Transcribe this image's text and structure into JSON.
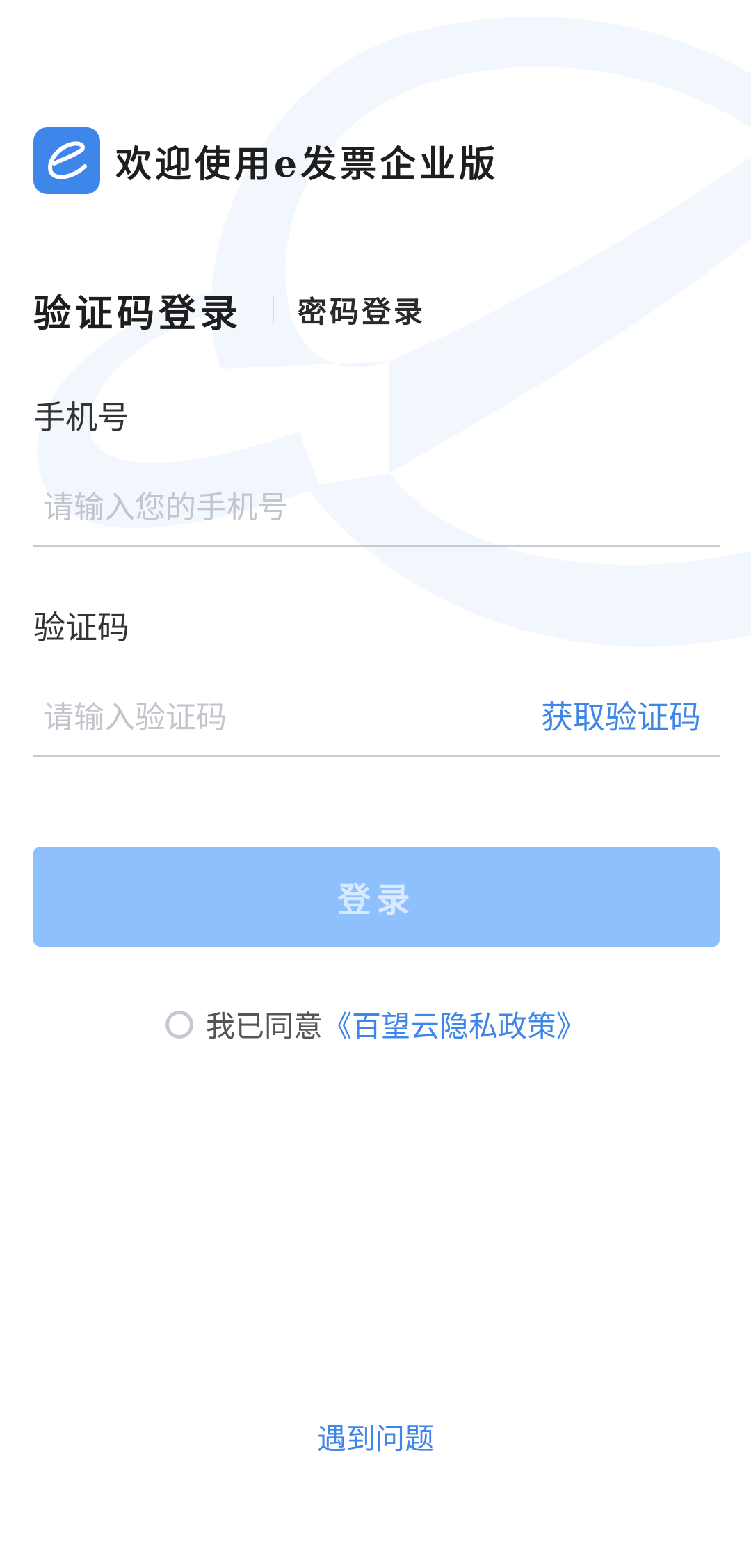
{
  "header": {
    "logo_icon": "e-logo-icon",
    "title": "欢迎使用e发票企业版"
  },
  "tabs": {
    "active": "验证码登录",
    "inactive": "密码登录"
  },
  "phone": {
    "label": "手机号",
    "placeholder": "请输入您的手机号",
    "value": ""
  },
  "code": {
    "label": "验证码",
    "placeholder": "请输入验证码",
    "value": "",
    "get_code_label": "获取验证码"
  },
  "login": {
    "label": "登录",
    "enabled": false
  },
  "agreement": {
    "checked": false,
    "text": "我已同意",
    "policy_link": "《百望云隐私政策》"
  },
  "help": {
    "label": "遇到问题"
  },
  "colors": {
    "accent": "#3f86ea",
    "button_disabled": "#8ec0fd",
    "watermark": "#f2f6fd"
  }
}
